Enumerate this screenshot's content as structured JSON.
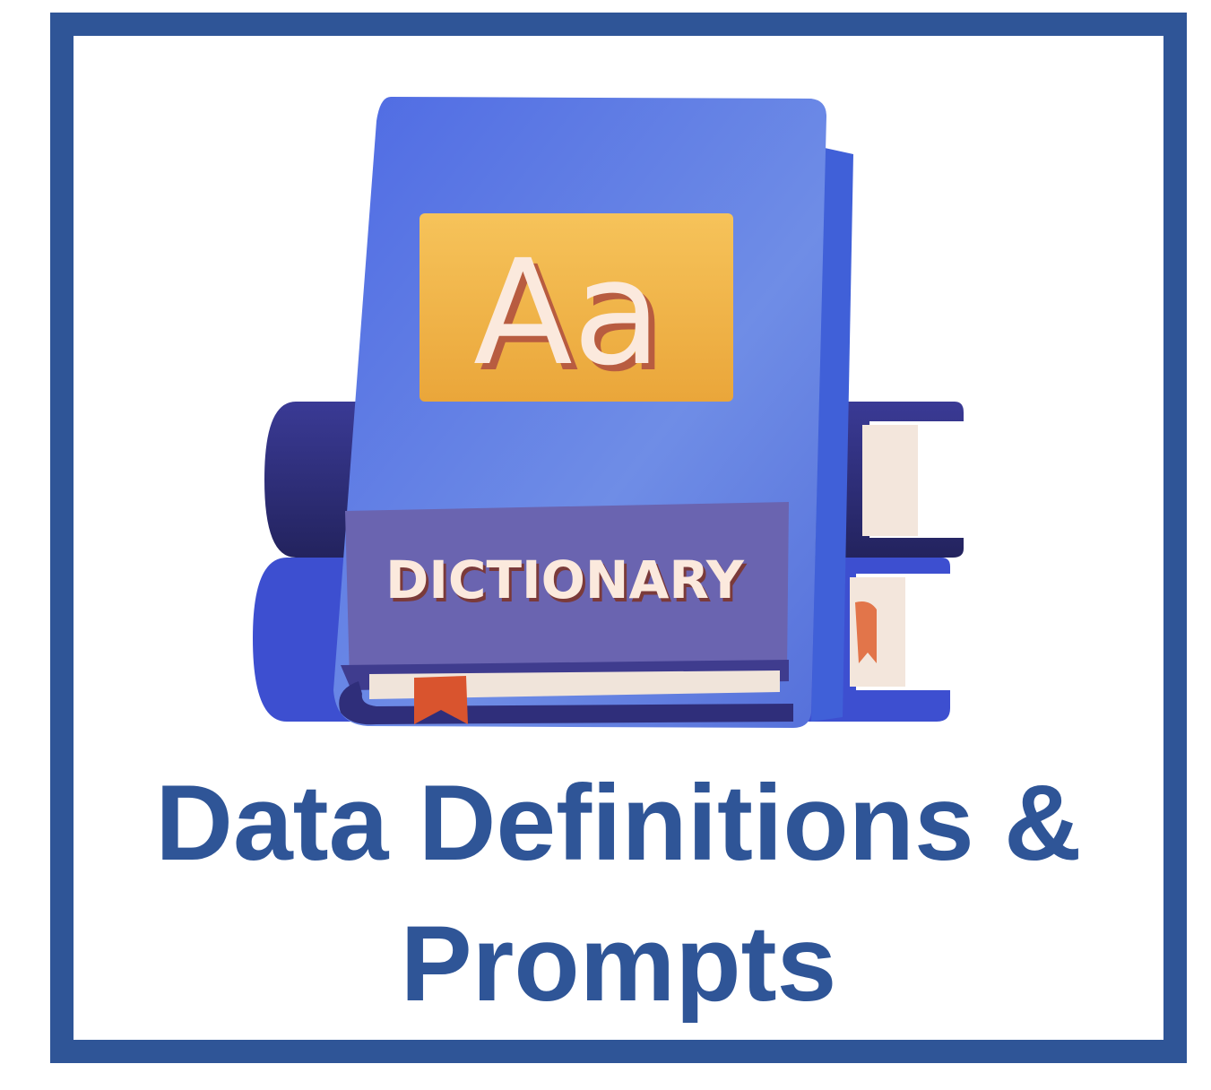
{
  "tile": {
    "border_color": "#2F5597",
    "caption_line1": "Data Definitions &",
    "caption_line2": "Prompts",
    "caption_color": "#2F5597"
  },
  "illustration": {
    "icon_name": "dictionary-book-icon",
    "badge_text": "Aa",
    "band_text": "DICTIONARY",
    "colors": {
      "cover": "#5577E0",
      "badge": "#F3B94A",
      "band": "#6A64B0",
      "spine": "#2F2E7A",
      "bookmark": "#D9542E"
    }
  }
}
